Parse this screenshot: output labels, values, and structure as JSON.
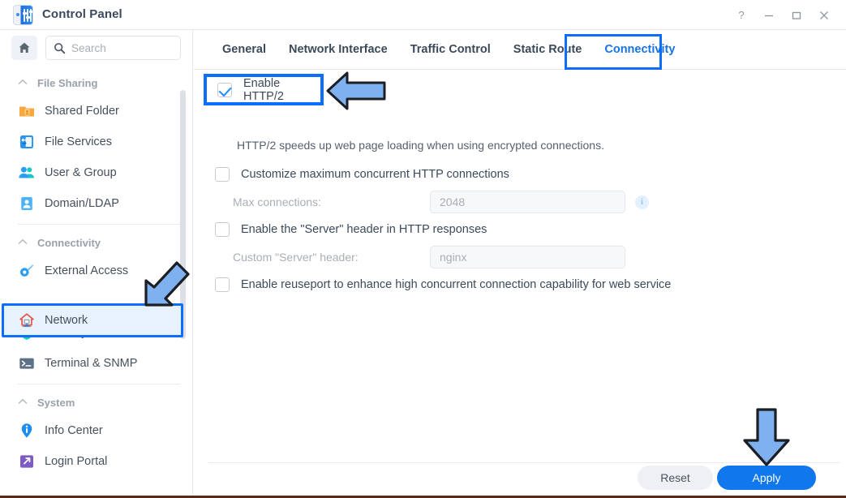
{
  "window": {
    "title": "Control Panel",
    "app_icon": "control-panel-icon",
    "controls": [
      {
        "name": "help-button",
        "glyph": "?"
      },
      {
        "name": "minimize-button",
        "glyph": "–"
      },
      {
        "name": "maximize-button",
        "glyph": "□"
      },
      {
        "name": "close-button",
        "glyph": "✕"
      }
    ]
  },
  "sidebar": {
    "home_button_icon": "home-icon",
    "search": {
      "placeholder": "Search",
      "value": "",
      "icon": "search-icon"
    },
    "groups": [
      {
        "label": "File Sharing",
        "collapse_icon": "chevron-up-icon",
        "items": [
          {
            "label": "Shared Folder",
            "icon": "shared-folder-icon"
          },
          {
            "label": "File Services",
            "icon": "file-services-icon"
          },
          {
            "label": "User & Group",
            "icon": "user-group-icon"
          },
          {
            "label": "Domain/LDAP",
            "icon": "domain-ldap-icon"
          }
        ]
      },
      {
        "label": "Connectivity",
        "collapse_icon": "chevron-up-icon",
        "items": [
          {
            "label": "External Access",
            "icon": "external-access-icon"
          },
          {
            "label": "Network",
            "icon": "network-icon",
            "selected": true
          },
          {
            "label": "Security",
            "icon": "security-shield-icon"
          },
          {
            "label": "Terminal & SNMP",
            "icon": "terminal-icon"
          }
        ]
      },
      {
        "label": "System",
        "collapse_icon": "chevron-up-icon",
        "items": [
          {
            "label": "Info Center",
            "icon": "info-center-icon"
          },
          {
            "label": "Login Portal",
            "icon": "login-portal-icon"
          }
        ]
      }
    ]
  },
  "tabs": [
    {
      "label": "General",
      "active": false
    },
    {
      "label": "Network Interface",
      "active": false
    },
    {
      "label": "Traffic Control",
      "active": false
    },
    {
      "label": "Static Route",
      "active": false
    },
    {
      "label": "Connectivity",
      "active": true
    }
  ],
  "settings": {
    "http2": {
      "label": "Enable HTTP/2",
      "checked": true,
      "description": "HTTP/2 speeds up web page loading when using encrypted connections."
    },
    "max_connections": {
      "label": "Customize maximum concurrent HTTP connections",
      "checked": false,
      "field_label": "Max connections:",
      "field_value": "2048",
      "info_icon": "info-icon"
    },
    "server_header": {
      "label": "Enable the \"Server\" header in HTTP responses",
      "checked": false,
      "field_label": "Custom \"Server\" header:",
      "field_value": "nginx"
    },
    "reuseport": {
      "label": "Enable reuseport to enhance high concurrent connection capability for web service",
      "checked": false
    }
  },
  "footer": {
    "reset_label": "Reset",
    "apply_label": "Apply"
  },
  "annotations": {
    "highlight_color": "#0d6efd",
    "arrow_fill": "#7fb0f0",
    "arrow_stroke": "#1b1f24",
    "arrows": [
      {
        "name": "arrow-to-enable-http2",
        "direction": "left"
      },
      {
        "name": "arrow-to-network-sidebar-item",
        "direction": "down-left"
      },
      {
        "name": "arrow-to-apply-button",
        "direction": "down"
      }
    ],
    "boxes": [
      {
        "name": "highlight-box-connectivity-tab"
      },
      {
        "name": "highlight-box-enable-http2"
      },
      {
        "name": "highlight-box-network-item"
      }
    ]
  },
  "theme": {
    "accent": "#1177ec",
    "tab_active": "#1673e6",
    "text": "#3b4a5a",
    "muted": "#a8aeb6"
  }
}
